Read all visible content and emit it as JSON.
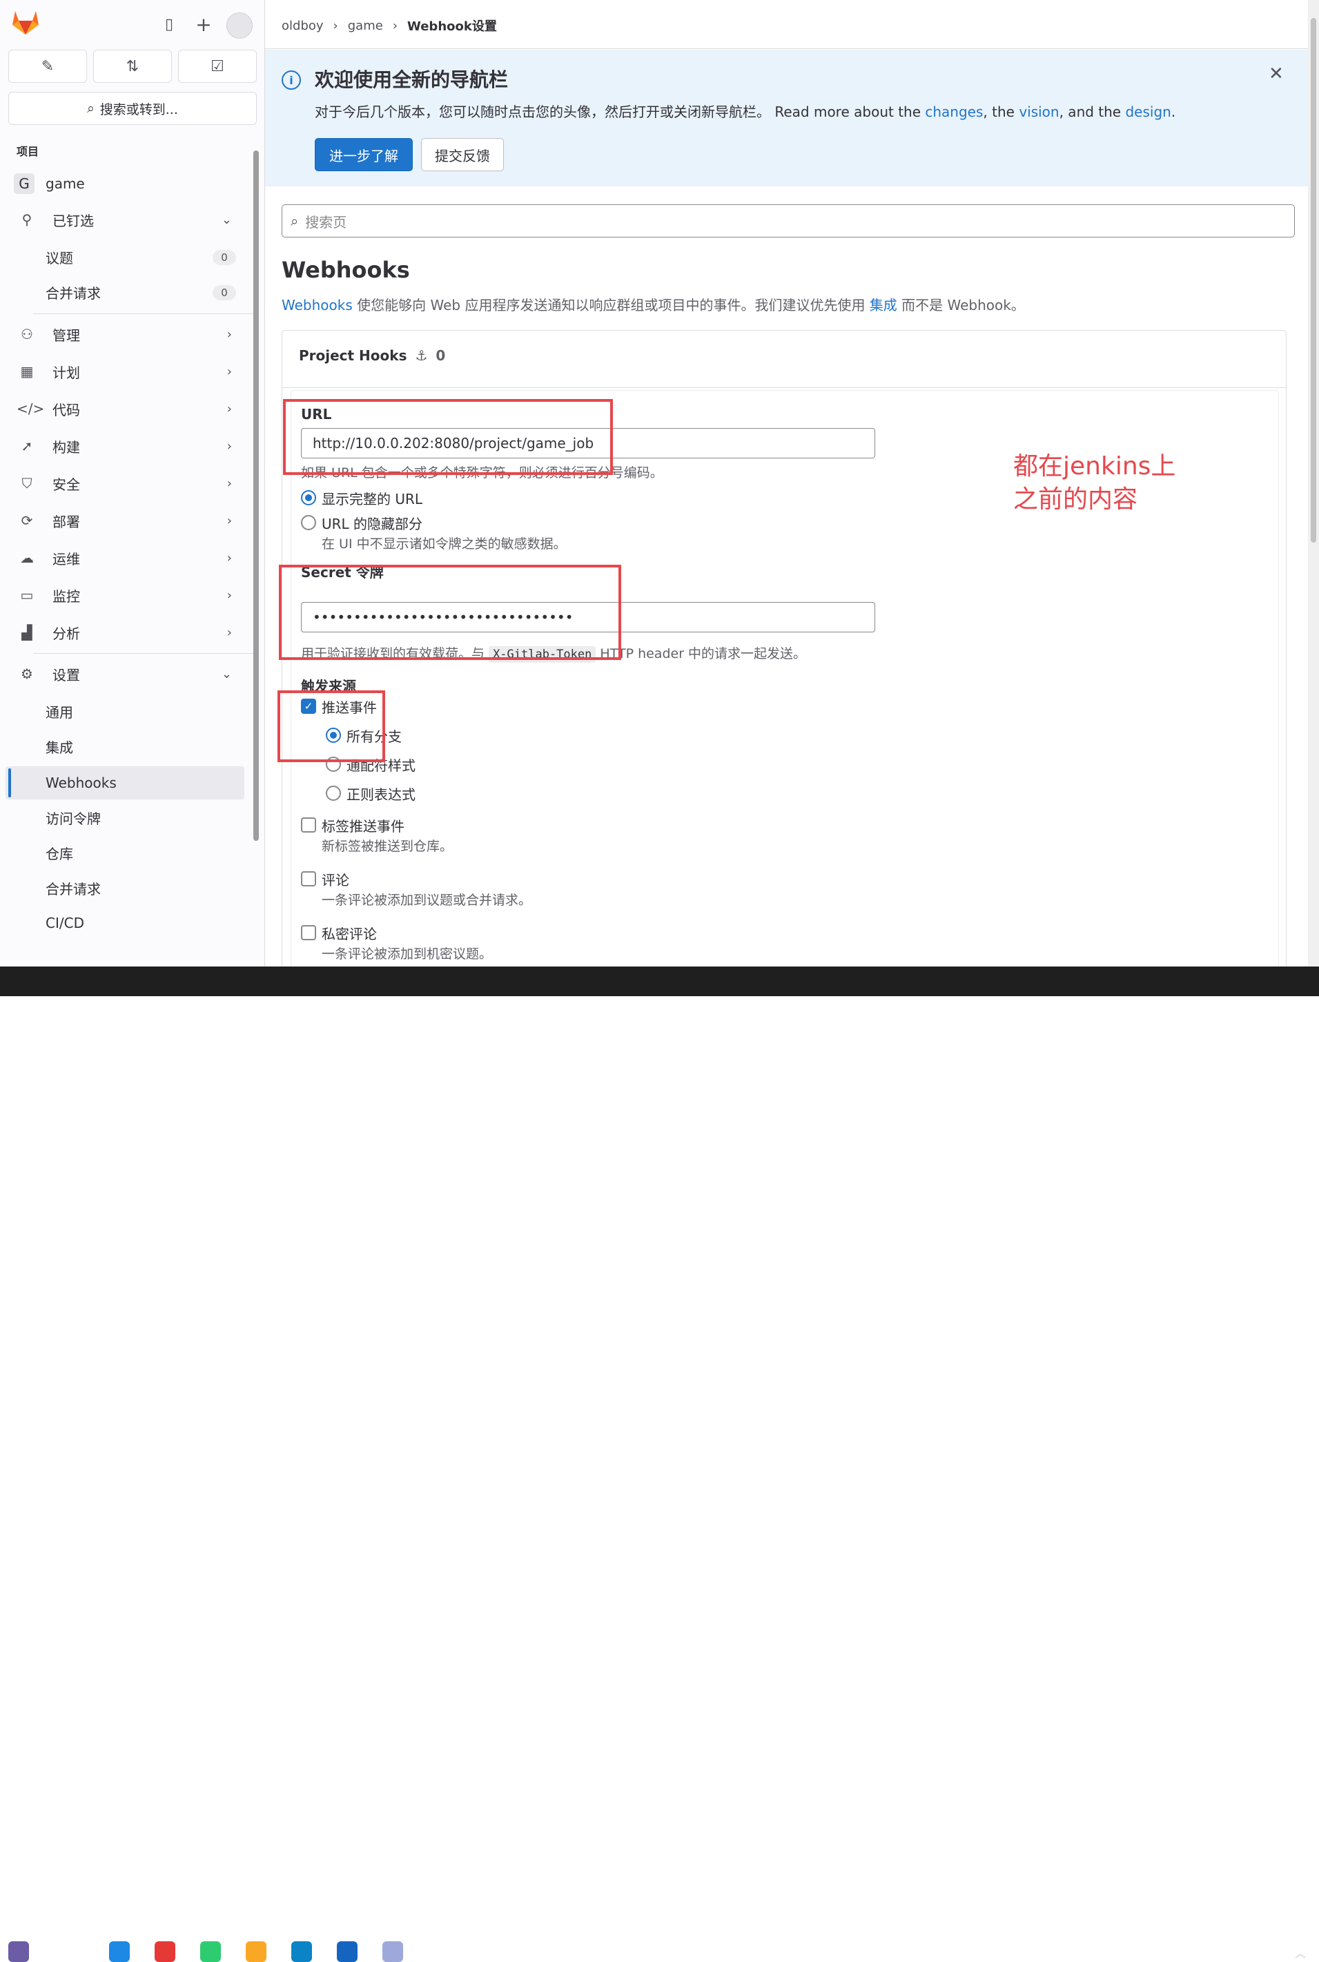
{
  "breadcrumb": {
    "items": [
      "oldboy",
      "game"
    ],
    "current": "Webhook设置",
    "separator": "›"
  },
  "sidebar": {
    "search_label": "搜索或转到...",
    "section_title": "项目",
    "project": {
      "initial": "G",
      "name": "game"
    },
    "pinned": {
      "label": "已钉选",
      "items": [
        {
          "label": "议题",
          "count": "0"
        },
        {
          "label": "合并请求",
          "count": "0"
        }
      ]
    },
    "nav": [
      {
        "label": "管理",
        "icon": "users-icon"
      },
      {
        "label": "计划",
        "icon": "calendar-icon"
      },
      {
        "label": "代码",
        "icon": "code-icon"
      },
      {
        "label": "构建",
        "icon": "rocket-icon"
      },
      {
        "label": "安全",
        "icon": "shield-icon"
      },
      {
        "label": "部署",
        "icon": "deploy-icon"
      },
      {
        "label": "运维",
        "icon": "cloud-gear-icon"
      },
      {
        "label": "监控",
        "icon": "monitor-icon"
      },
      {
        "label": "分析",
        "icon": "chart-icon"
      }
    ],
    "settings": {
      "label": "设置",
      "items": [
        "通用",
        "集成",
        "Webhooks",
        "访问令牌",
        "仓库",
        "合并请求",
        "CI/CD"
      ],
      "active": "Webhooks"
    }
  },
  "banner": {
    "title": "欢迎使用全新的导航栏",
    "text_prefix": "对于今后几个版本，您可以随时点击您的头像，然后打开或关闭新导航栏。 Read more about the ",
    "link1": "changes",
    "sep1": ", the ",
    "link2": "vision",
    "sep2": ", and the ",
    "link3": "design",
    "end": ".",
    "primary_button": "进一步了解",
    "secondary_button": "提交反馈"
  },
  "search_page_placeholder": "搜索页",
  "page_title": "Webhooks",
  "description": {
    "link": "Webhooks",
    "mid": " 使您能够向 Web 应用程序发送通知以响应群组或项目中的事件。我们建议优先使用 ",
    "link2": "集成",
    "end": " 而不是 Webhook。"
  },
  "hooks": {
    "title": "Project Hooks",
    "count": "0"
  },
  "form": {
    "url_label": "URL",
    "url_value": "http://10.0.0.202:8080/project/game_job",
    "url_hint": "如果 URL 包含一个或多个特殊字符，则必须进行百分号编码。",
    "mask_options": [
      "显示完整的 URL",
      "URL 的隐藏部分"
    ],
    "mask_hint": "在 UI 中不显示诸如令牌之类的敏感数据。",
    "secret_label": "Secret 令牌",
    "secret_value": "••••••••••••••••••••••••••••••••",
    "secret_hint_prefix": "用于验证接收到的有效载荷。与",
    "secret_hint_code": "X-Gitlab-Token",
    "secret_hint_suffix": "HTTP header 中的请求一起发送。",
    "triggers_label": "触发来源",
    "push_events": "推送事件",
    "branch_options": [
      "所有分支",
      "通配符样式",
      "正则表达式"
    ],
    "tag_push": "标签推送事件",
    "tag_push_hint": "新标签被推送到仓库。",
    "comments": "评论",
    "comments_hint": "一条评论被添加到议题或合并请求。",
    "confidential_comments": "私密评论",
    "confidential_comments_hint": "一条评论被添加到机密议题。"
  },
  "annotation": {
    "line1": "都在jenkins上",
    "line2": "之前的内容"
  },
  "colors": {
    "accent": "#1f75cb",
    "annotation": "#e5484d",
    "banner_bg": "#e9f3fc"
  }
}
